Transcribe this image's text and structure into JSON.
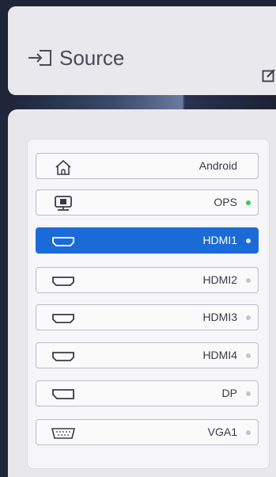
{
  "header": {
    "title": "Source",
    "icon": "input-source-icon",
    "edit_icon": "edit-icon"
  },
  "sources": [
    {
      "label": "Android",
      "icon": "home-icon",
      "status": "none"
    },
    {
      "label": "OPS",
      "icon": "ops-pc-icon",
      "status": "connected"
    },
    {
      "label": "HDMI1",
      "icon": "hdmi-icon",
      "status": "inactive",
      "selected": true
    },
    {
      "label": "HDMI2",
      "icon": "hdmi-icon",
      "status": "inactive"
    },
    {
      "label": "HDMI3",
      "icon": "hdmi-icon",
      "status": "inactive"
    },
    {
      "label": "HDMI4",
      "icon": "hdmi-icon",
      "status": "inactive"
    },
    {
      "label": "DP",
      "icon": "displayport-icon",
      "status": "inactive"
    },
    {
      "label": "VGA1",
      "icon": "vga-icon",
      "status": "inactive"
    }
  ],
  "colors": {
    "selected": "#1a6bd8",
    "connected": "#33cc55",
    "inactive": "#c4c4ca"
  }
}
